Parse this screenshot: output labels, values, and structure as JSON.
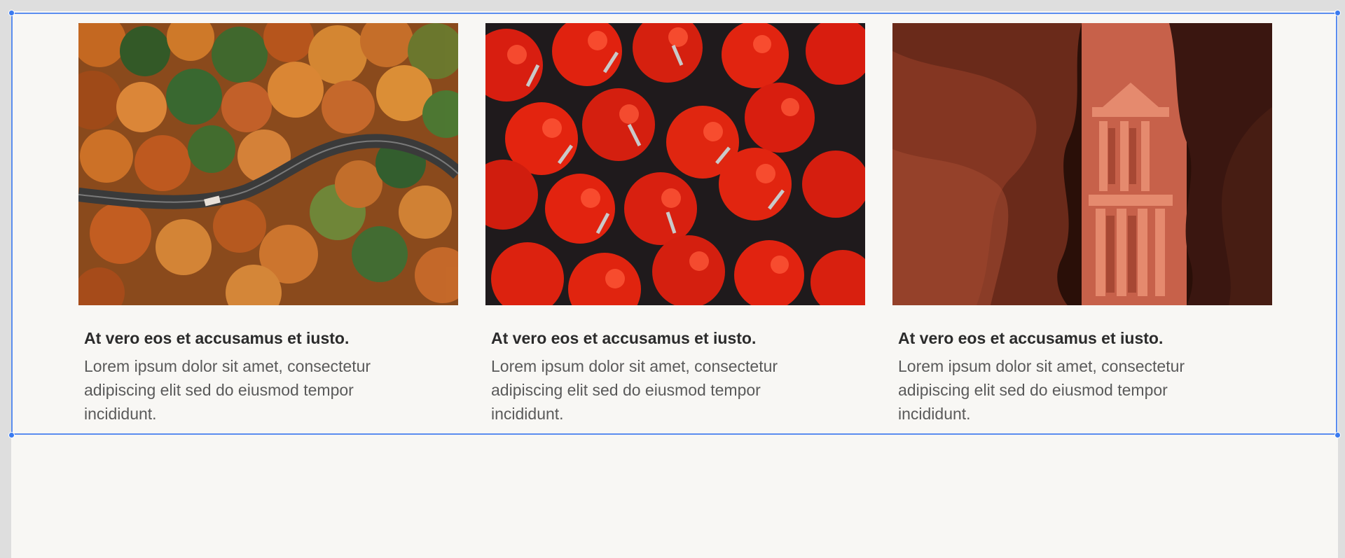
{
  "cards": [
    {
      "image_subject": "aerial autumn forest with winding road",
      "title": "At vero eos et accusamus et iusto.",
      "body": "Lorem ipsum dolor sit amet, consectetur adipiscing elit sed do eiusmod tempor incididunt."
    },
    {
      "image_subject": "red fire extinguishers from above",
      "title": "At vero eos et accusamus et iusto.",
      "body": "Lorem ipsum dolor sit amet, consectetur adipiscing elit sed do eiusmod tempor incididunt."
    },
    {
      "image_subject": "Petra Treasury through canyon walls",
      "title": "At vero eos et accusamus et iusto.",
      "body": "Lorem ipsum dolor sit amet, consectetur adipiscing elit sed do eiusmod tempor incididunt."
    }
  ],
  "colors": {
    "canvas_background": "#f8f7f4",
    "selection_outline": "#5b8def",
    "title_text": "#2b2b2b",
    "body_text": "#5a5a5a"
  }
}
